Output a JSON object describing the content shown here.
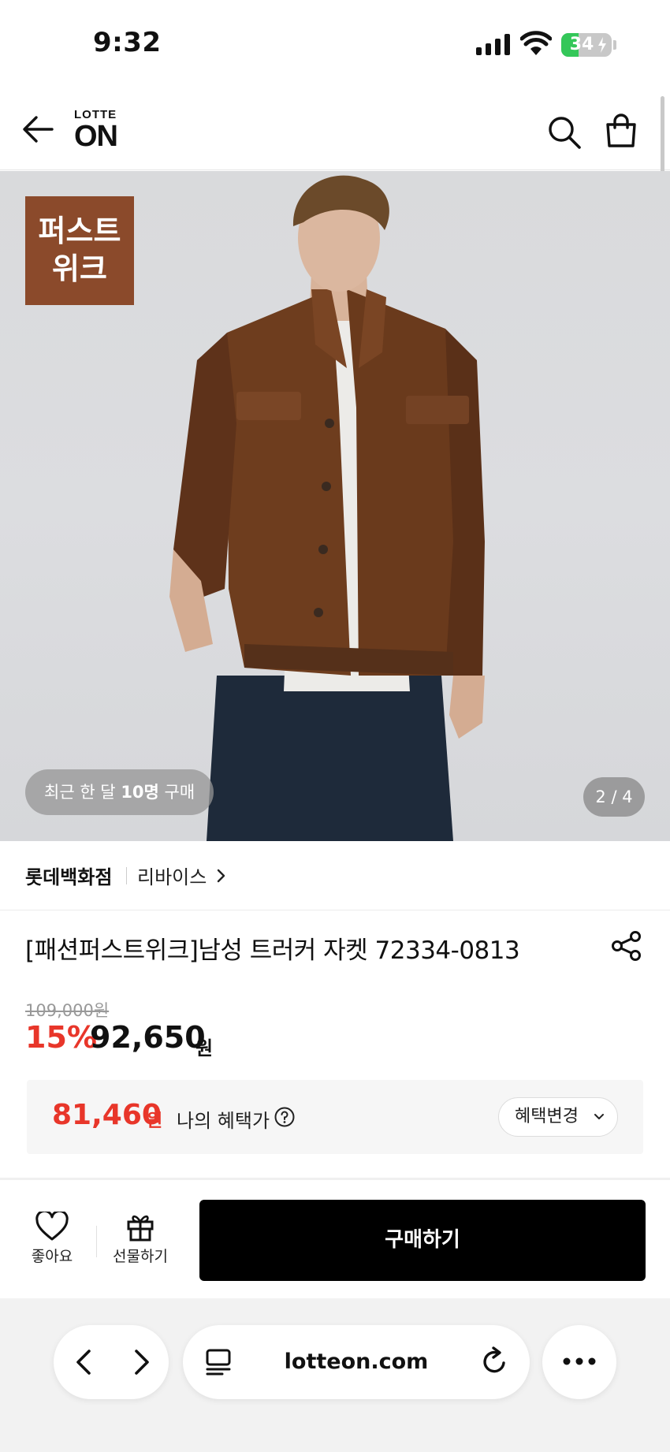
{
  "status_bar": {
    "time": "9:32",
    "battery": "34",
    "battery_level": 0.34
  },
  "header": {
    "logo_small": "LOTTE",
    "logo_big": "ON"
  },
  "product_image": {
    "badge_line1": "퍼스트",
    "badge_line2": "위크",
    "recent_prefix": "최근 한 달 ",
    "recent_count": "10명",
    "recent_suffix": " 구매",
    "page_counter": "2 / 4"
  },
  "seller": {
    "store": "롯데백화점",
    "brand": "리바이스"
  },
  "product": {
    "title": "[패션퍼스트위크]남성 트러커 자켓 72334-0813"
  },
  "price": {
    "original": "109,000원",
    "discount_rate": "15%",
    "sale_price": "92,650",
    "unit": "원"
  },
  "benefit": {
    "price": "81,460",
    "unit": "원",
    "label": "나의 혜택가",
    "change_button": "혜택변경"
  },
  "actions": {
    "like_label": "좋아요",
    "gift_label": "선물하기",
    "buy_label": "구매하기"
  },
  "browser": {
    "url": "lotteon.com"
  },
  "colors": {
    "accent_red": "#e8362a",
    "badge_brown": "#8b4a2b",
    "buy_black": "#000000"
  }
}
